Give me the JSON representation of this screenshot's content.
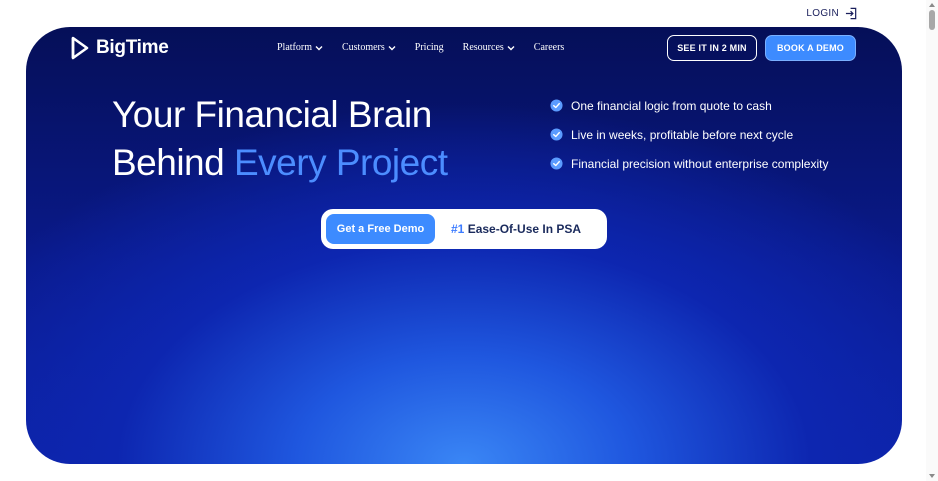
{
  "topbar": {
    "login_label": "LOGIN"
  },
  "header": {
    "logo_text": "BigTime",
    "nav": [
      {
        "label": "Platform",
        "has_dropdown": true
      },
      {
        "label": "Customers",
        "has_dropdown": true
      },
      {
        "label": "Pricing",
        "has_dropdown": false
      },
      {
        "label": "Resources",
        "has_dropdown": true
      },
      {
        "label": "Careers",
        "has_dropdown": false
      }
    ],
    "see_it_label": "SEE IT IN 2 MIN",
    "book_demo_label": "BOOK A DEMO"
  },
  "hero": {
    "headline_line1": "Your Financial Brain",
    "headline_line2_prefix": "Behind ",
    "headline_line2_accent": "Every Project",
    "features": [
      "One financial logic from quote to cash",
      "Live in weeks, profitable before next cycle",
      "Financial precision without enterprise complexity"
    ],
    "cta_button_label": "Get a Free Demo",
    "cta_rank": "#1",
    "cta_tagline": " Ease-Of-Use In PSA"
  },
  "colors": {
    "hero_dark": "#050f58",
    "hero_glow": "#3a86f5",
    "accent_blue": "#3d8bff",
    "headline_accent": "#4c8dff"
  },
  "icons": {
    "login": "sign-in-icon",
    "logo": "bigtime-logo-icon",
    "dropdown": "chevron-down-icon",
    "feature": "check-circle-icon"
  }
}
